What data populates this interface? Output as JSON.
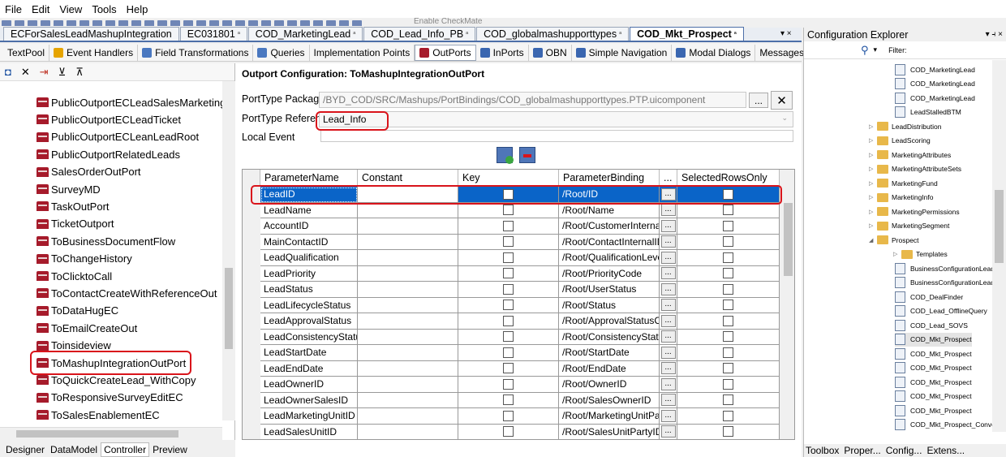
{
  "menu": [
    "File",
    "Edit",
    "View",
    "Tools",
    "Help"
  ],
  "toolbar": {
    "enable_checkmate": "Enable CheckMate"
  },
  "doc_tabs": [
    {
      "label": "ECForSalesLeadMashupIntegration",
      "active": false
    },
    {
      "label": "EC031801",
      "active": false
    },
    {
      "label": "COD_MarketingLead",
      "active": false
    },
    {
      "label": "COD_Lead_Info_PB",
      "active": false
    },
    {
      "label": "COD_globalmashupporttypes",
      "active": false
    },
    {
      "label": "COD_Mkt_Prospect",
      "active": true
    }
  ],
  "doc_close": "▾ ×",
  "sub_tabs": [
    {
      "label": "TextPool",
      "icon": "none"
    },
    {
      "label": "Event Handlers",
      "icon": "lightning-icon"
    },
    {
      "label": "Field Transformations",
      "icon": "transform-icon"
    },
    {
      "label": "Queries",
      "icon": "query-icon"
    },
    {
      "label": "Implementation Points",
      "icon": "none"
    },
    {
      "label": "OutPorts",
      "icon": "outport-icon",
      "active": true
    },
    {
      "label": "InPorts",
      "icon": "inport-icon"
    },
    {
      "label": "OBN",
      "icon": "obn-icon"
    },
    {
      "label": "Simple Navigation",
      "icon": "nav-icon"
    },
    {
      "label": "Modal Dialogs",
      "icon": "dialog-icon"
    },
    {
      "label": "Messages",
      "icon": "none"
    }
  ],
  "left_tree": [
    "PublicOutportECLeadSalesMarketingTea",
    "PublicOutportECLeadTicket",
    "PublicOutportECLeanLeadRoot",
    "PublicOutportRelatedLeads",
    "SalesOrderOutPort",
    "SurveyMD",
    "TaskOutPort",
    "TicketOutport",
    "ToBusinessDocumentFlow",
    "ToChangeHistory",
    "ToClicktoCall",
    "ToContactCreateWithReferenceOut",
    "ToDataHugEC",
    "ToEmailCreateOut",
    "Toinsideview",
    "ToMashupIntegrationOutPort",
    "ToQuickCreateLead_WithCopy",
    "ToResponsiveSurveyEditEC",
    "ToSalesEnablementEC"
  ],
  "bottom_tabs": [
    {
      "label": "Designer",
      "active": false
    },
    {
      "label": "DataModel",
      "active": false
    },
    {
      "label": "Controller",
      "active": true
    },
    {
      "label": "Preview",
      "active": false
    }
  ],
  "outport": {
    "title": "Outport Configuration: ToMashupIntegrationOutPort",
    "porttype_package_label": "PortType Package",
    "porttype_package_value": "/BYD_COD/SRC/Mashups/PortBindings/COD_globalmashupporttypes.PTP.uicomponent",
    "porttype_reference_label": "PortType Reference",
    "porttype_reference_value": "Lead_Info",
    "local_event_label": "Local Event",
    "local_event_value": "",
    "browse_button": "...",
    "clear_button": "✕"
  },
  "grid": {
    "columns": [
      "ParameterName",
      "Constant",
      "Key",
      "ParameterBinding",
      "...",
      "SelectedRowsOnly"
    ],
    "rows": [
      {
        "name": "LeadID",
        "binding": "/Root/ID",
        "selected": true
      },
      {
        "name": "LeadName",
        "binding": "/Root/Name"
      },
      {
        "name": "AccountID",
        "binding": "/Root/CustomerInternalID"
      },
      {
        "name": "MainContactID",
        "binding": "/Root/ContactInternalID"
      },
      {
        "name": "LeadQualification",
        "binding": "/Root/QualificationLevelC"
      },
      {
        "name": "LeadPriority",
        "binding": "/Root/PriorityCode"
      },
      {
        "name": "LeadStatus",
        "binding": "/Root/UserStatus"
      },
      {
        "name": "LeadLifecycleStatus",
        "binding": "/Root/Status"
      },
      {
        "name": "LeadApprovalStatus",
        "binding": "/Root/ApprovalStatusCod"
      },
      {
        "name": "LeadConsistencyStatus",
        "binding": "/Root/ConsistencyStatus("
      },
      {
        "name": "LeadStartDate",
        "binding": "/Root/StartDate"
      },
      {
        "name": "LeadEndDate",
        "binding": "/Root/EndDate"
      },
      {
        "name": "LeadOwnerID",
        "binding": "/Root/OwnerID"
      },
      {
        "name": "LeadOwnerSalesID",
        "binding": "/Root/SalesOwnerID"
      },
      {
        "name": "LeadMarketingUnitID",
        "binding": "/Root/MarketingUnitPartyI"
      },
      {
        "name": "LeadSalesUnitID",
        "binding": "/Root/SalesUnitPartyID"
      }
    ],
    "ellipsis": "..."
  },
  "config_explorer": {
    "title": "Configuration Explorer",
    "title_controls": "▾ ⫞ ×",
    "filter_label": "Filter:",
    "nodes": [
      {
        "label": "COD_MarketingLead",
        "type": "file",
        "indent": 2
      },
      {
        "label": "COD_MarketingLead",
        "type": "file",
        "indent": 2
      },
      {
        "label": "COD_MarketingLead",
        "type": "file",
        "indent": 2
      },
      {
        "label": "LeadStalledBTM",
        "type": "file",
        "indent": 2
      },
      {
        "label": "LeadDistribution",
        "type": "folder",
        "indent": 1
      },
      {
        "label": "LeadScoring",
        "type": "folder",
        "indent": 1
      },
      {
        "label": "MarketingAttributes",
        "type": "folder",
        "indent": 1
      },
      {
        "label": "MarketingAttributeSets",
        "type": "folder",
        "indent": 1
      },
      {
        "label": "MarketingFund",
        "type": "folder",
        "indent": 1
      },
      {
        "label": "MarketingInfo",
        "type": "folder",
        "indent": 1
      },
      {
        "label": "MarketingPermissions",
        "type": "folder",
        "indent": 1
      },
      {
        "label": "MarketingSegment",
        "type": "folder",
        "indent": 1
      },
      {
        "label": "Prospect",
        "type": "folder-open",
        "indent": 1
      },
      {
        "label": "Templates",
        "type": "folder",
        "indent": 2
      },
      {
        "label": "BusinessConfigurationLeadAgi",
        "type": "file",
        "indent": 2
      },
      {
        "label": "BusinessConfigurationLeadDup",
        "type": "file",
        "indent": 2
      },
      {
        "label": "COD_DealFinder",
        "type": "file",
        "indent": 2
      },
      {
        "label": "COD_Lead_OfflineQuery",
        "type": "file",
        "indent": 2
      },
      {
        "label": "COD_Lead_SOVS",
        "type": "file",
        "indent": 2
      },
      {
        "label": "COD_Mkt_Prospect",
        "type": "file",
        "indent": 2,
        "selected": true
      },
      {
        "label": "COD_Mkt_Prospect",
        "type": "file",
        "indent": 2
      },
      {
        "label": "COD_Mkt_Prospect",
        "type": "file",
        "indent": 2
      },
      {
        "label": "COD_Mkt_Prospect",
        "type": "file",
        "indent": 2
      },
      {
        "label": "COD_Mkt_Prospect",
        "type": "file",
        "indent": 2
      },
      {
        "label": "COD_Mkt_Prospect",
        "type": "file",
        "indent": 2
      },
      {
        "label": "COD_Mkt_Prospect_Convert",
        "type": "file",
        "indent": 2
      }
    ],
    "bottom_tabs": [
      "Toolbox",
      "Proper...",
      "Config...",
      "Extens..."
    ]
  }
}
